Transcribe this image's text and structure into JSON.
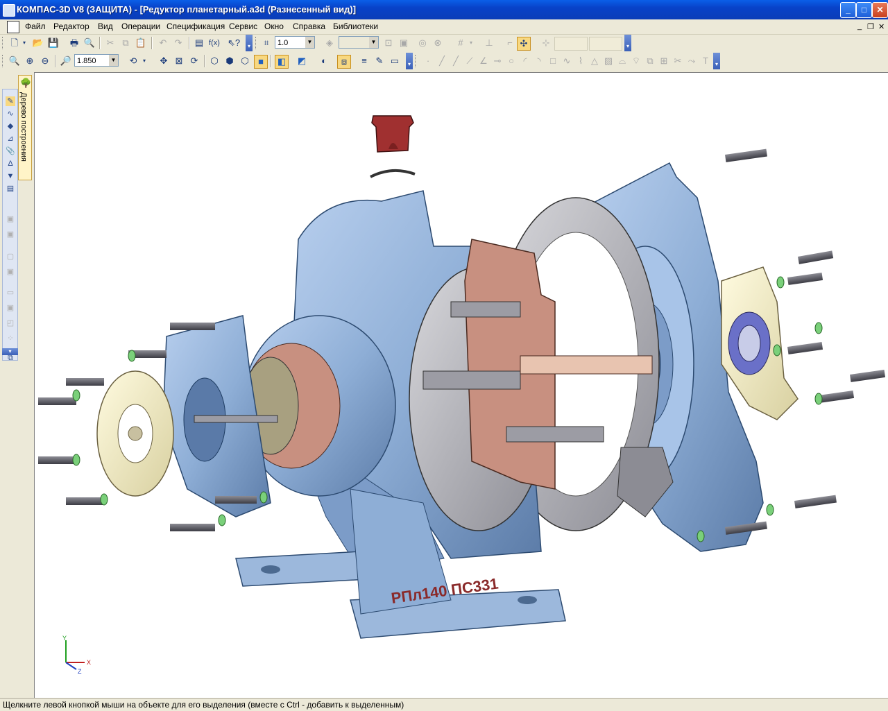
{
  "window": {
    "title": "КОМПАС-3D V8 (ЗАЩИТА) - [Редуктор планетарный.a3d (Разнесенный вид)]",
    "buttons": {
      "minimize": "_",
      "maximize": "□",
      "close": "✕"
    }
  },
  "menu": {
    "items": [
      "Файл",
      "Редактор",
      "Вид",
      "Операции",
      "Спецификация",
      "Сервис",
      "Окно",
      "Справка",
      "Библиотеки"
    ],
    "mdi": {
      "minimize": "_",
      "restore": "❐",
      "close": "✕"
    }
  },
  "toolbar1": {
    "step_value": "1.0"
  },
  "toolbar2": {
    "zoom_value": "1.850"
  },
  "left_panel": {
    "tree_tab_label": "Дерево построения"
  },
  "model": {
    "engraving": "РПл140 ПС331",
    "colors": {
      "housing": "#8eaed6",
      "housing_dark": "#3c5a80",
      "section_copper": "#c89080",
      "gear_gray": "#b4b4b8",
      "cap_cream": "#f4f0cc",
      "red_part": "#a03030"
    }
  },
  "axes": {
    "x": "X",
    "y": "Y",
    "z": "Z"
  },
  "status": {
    "message": "Щелкните левой кнопкой мыши на объекте для его выделения (вместе с Ctrl - добавить к выделенным)"
  }
}
